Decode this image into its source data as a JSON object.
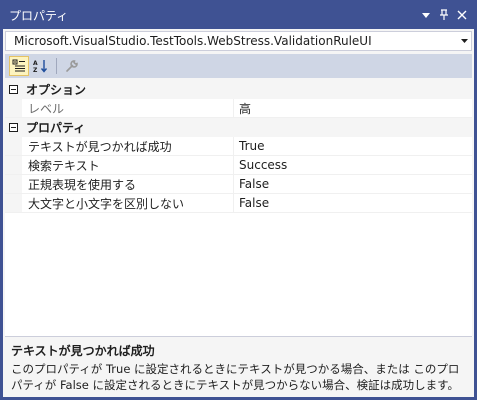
{
  "window": {
    "title": "プロパティ"
  },
  "object_selector": {
    "value": "Microsoft.VisualStudio.TestTools.WebStress.ValidationRuleUI"
  },
  "categories": [
    {
      "label": "オプション",
      "toggle": "⊟",
      "properties": [
        {
          "name": "レベル",
          "value": "高"
        }
      ]
    },
    {
      "label": "プロパティ",
      "toggle": "⊟",
      "properties": [
        {
          "name": "テキストが見つかれば成功",
          "value": "True"
        },
        {
          "name": "検索テキスト",
          "value": "Success"
        },
        {
          "name": "正規表現を使用する",
          "value": "False"
        },
        {
          "name": "大文字と小文字を区別しない",
          "value": "False"
        }
      ]
    }
  ],
  "description": {
    "title": "テキストが見つかれば成功",
    "text": "このプロパティが True に設定されるときにテキストが見つかる場合、または このプロパティが False に設定されるときにテキストが見つからない場合、検証は成功します。"
  },
  "colors": {
    "titlebar": "#3F5293",
    "toolbar": "#CFD6E5",
    "active_tool": "#FDF4BF"
  },
  "icons": {
    "dropdown": "dropdown-arrow-icon",
    "pin": "pin-icon",
    "close": "close-icon",
    "categorized": "categorized-icon",
    "alphabetical": "alphabetical-icon",
    "property_pages": "wrench-icon"
  }
}
